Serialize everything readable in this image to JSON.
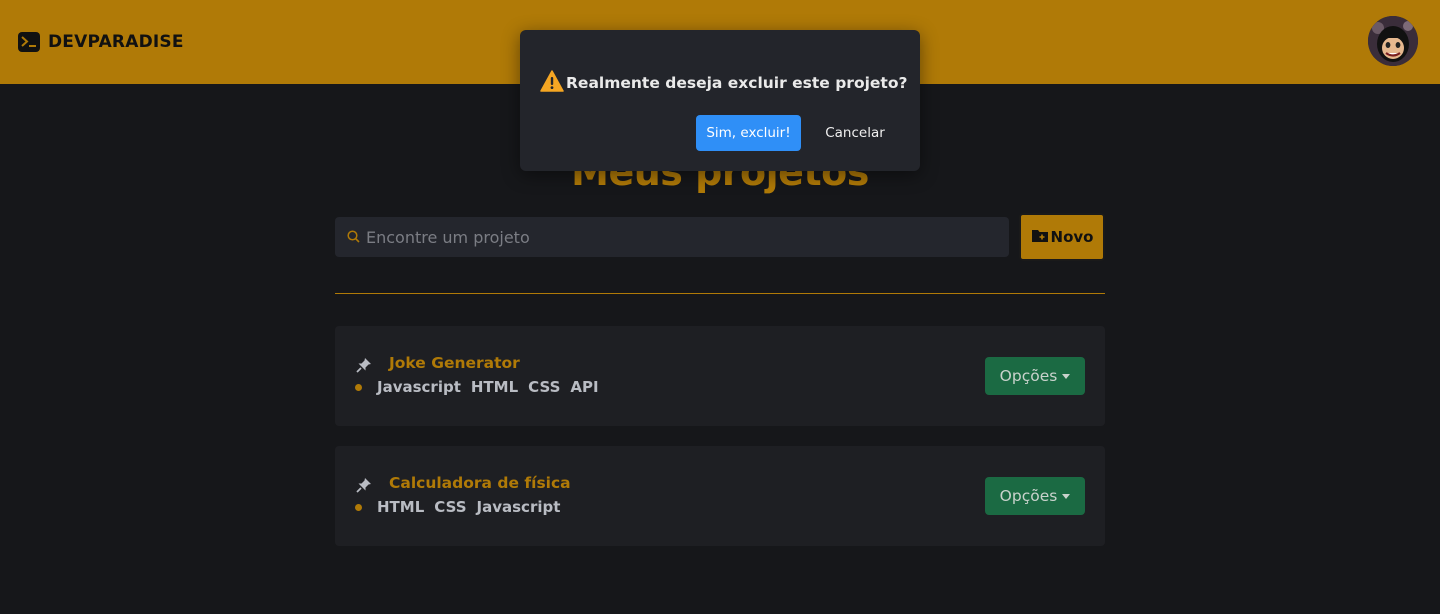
{
  "header": {
    "brand": "DEVPARADISE",
    "brand_icon": "terminal-icon",
    "avatar_icon": "user-avatar"
  },
  "main": {
    "title": "Meus projetos",
    "search": {
      "placeholder": "Encontre um projeto",
      "value": "",
      "icon": "search-icon"
    },
    "new_button": {
      "label": "Novo",
      "icon": "folder-plus-icon"
    }
  },
  "projects": [
    {
      "title": "Joke Generator",
      "tags": [
        "Javascript",
        "HTML",
        "CSS",
        "API"
      ],
      "options_label": "Opções"
    },
    {
      "title": "Calculadora de física",
      "tags": [
        "HTML",
        "CSS",
        "Javascript"
      ],
      "options_label": "Opções"
    }
  ],
  "dialog": {
    "message": "Realmente deseja excluir este projeto?",
    "icon": "warning-icon",
    "confirm_label": "Sim, excluir!",
    "cancel_label": "Cancelar"
  },
  "colors": {
    "accent": "#b07a07",
    "background": "#16171a",
    "card": "#1e1f23",
    "options": "#1b6a43",
    "confirm": "#2f8ff7",
    "warning": "#f5a623"
  }
}
